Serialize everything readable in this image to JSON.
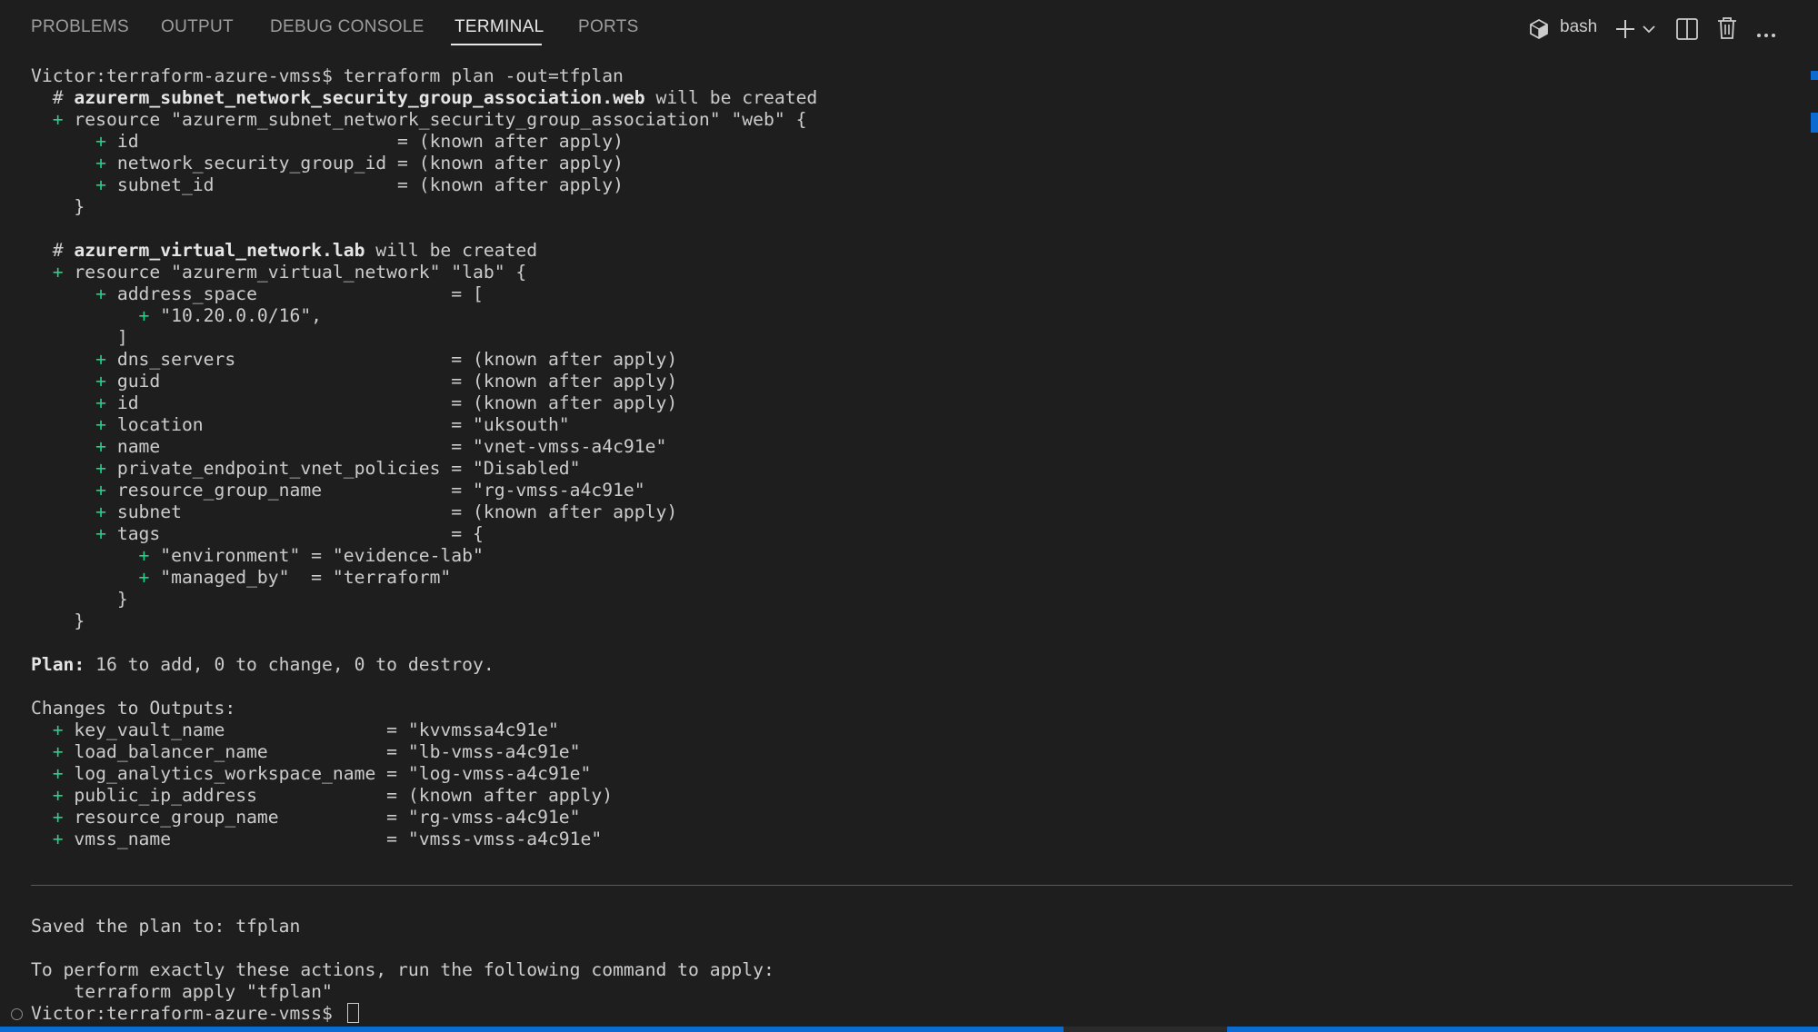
{
  "panel": {
    "tabs": [
      {
        "label": "PROBLEMS"
      },
      {
        "label": "OUTPUT"
      },
      {
        "label": "DEBUG CONSOLE"
      },
      {
        "label": "TERMINAL"
      },
      {
        "label": "PORTS"
      }
    ],
    "active_tab": "TERMINAL",
    "shell_label": "bash",
    "icons": {
      "shell": "terminal-shell-icon",
      "new_terminal": "plus-icon",
      "dropdown": "chevron-down-icon",
      "split": "split-terminal-icon",
      "kill": "trash-icon",
      "more": "ellipsis-icon"
    }
  },
  "terminal": {
    "lines": [
      [
        {
          "t": "Victor:terraform-azure-vmss$ terraform plan -out=tfplan"
        }
      ],
      [
        {
          "t": "  # "
        },
        {
          "t": "azurerm_subnet_network_security_group_association.web",
          "c": "bold"
        },
        {
          "t": " will be created"
        }
      ],
      [
        {
          "t": "  "
        },
        {
          "t": "+",
          "c": "plus"
        },
        {
          "t": " resource \"azurerm_subnet_network_security_group_association\" \"web\" {"
        }
      ],
      [
        {
          "t": "      "
        },
        {
          "t": "+",
          "c": "plus"
        },
        {
          "t": " id                        = (known after apply)"
        }
      ],
      [
        {
          "t": "      "
        },
        {
          "t": "+",
          "c": "plus"
        },
        {
          "t": " network_security_group_id = (known after apply)"
        }
      ],
      [
        {
          "t": "      "
        },
        {
          "t": "+",
          "c": "plus"
        },
        {
          "t": " subnet_id                 = (known after apply)"
        }
      ],
      [
        {
          "t": "    }"
        }
      ],
      [
        {
          "t": ""
        }
      ],
      [
        {
          "t": "  # "
        },
        {
          "t": "azurerm_virtual_network.lab",
          "c": "bold"
        },
        {
          "t": " will be created"
        }
      ],
      [
        {
          "t": "  "
        },
        {
          "t": "+",
          "c": "plus"
        },
        {
          "t": " resource \"azurerm_virtual_network\" \"lab\" {"
        }
      ],
      [
        {
          "t": "      "
        },
        {
          "t": "+",
          "c": "plus"
        },
        {
          "t": " address_space                  = ["
        }
      ],
      [
        {
          "t": "          "
        },
        {
          "t": "+",
          "c": "plus"
        },
        {
          "t": " \"10.20.0.0/16\","
        }
      ],
      [
        {
          "t": "        ]"
        }
      ],
      [
        {
          "t": "      "
        },
        {
          "t": "+",
          "c": "plus"
        },
        {
          "t": " dns_servers                    = (known after apply)"
        }
      ],
      [
        {
          "t": "      "
        },
        {
          "t": "+",
          "c": "plus"
        },
        {
          "t": " guid                           = (known after apply)"
        }
      ],
      [
        {
          "t": "      "
        },
        {
          "t": "+",
          "c": "plus"
        },
        {
          "t": " id                             = (known after apply)"
        }
      ],
      [
        {
          "t": "      "
        },
        {
          "t": "+",
          "c": "plus"
        },
        {
          "t": " location                       = \"uksouth\""
        }
      ],
      [
        {
          "t": "      "
        },
        {
          "t": "+",
          "c": "plus"
        },
        {
          "t": " name                           = \"vnet-vmss-a4c91e\""
        }
      ],
      [
        {
          "t": "      "
        },
        {
          "t": "+",
          "c": "plus"
        },
        {
          "t": " private_endpoint_vnet_policies = \"Disabled\""
        }
      ],
      [
        {
          "t": "      "
        },
        {
          "t": "+",
          "c": "plus"
        },
        {
          "t": " resource_group_name            = \"rg-vmss-a4c91e\""
        }
      ],
      [
        {
          "t": "      "
        },
        {
          "t": "+",
          "c": "plus"
        },
        {
          "t": " subnet                         = (known after apply)"
        }
      ],
      [
        {
          "t": "      "
        },
        {
          "t": "+",
          "c": "plus"
        },
        {
          "t": " tags                           = {"
        }
      ],
      [
        {
          "t": "          "
        },
        {
          "t": "+",
          "c": "plus"
        },
        {
          "t": " \"environment\" = \"evidence-lab\""
        }
      ],
      [
        {
          "t": "          "
        },
        {
          "t": "+",
          "c": "plus"
        },
        {
          "t": " \"managed_by\"  = \"terraform\""
        }
      ],
      [
        {
          "t": "        }"
        }
      ],
      [
        {
          "t": "    }"
        }
      ],
      [
        {
          "t": ""
        }
      ],
      [
        {
          "t": "Plan:",
          "c": "bold"
        },
        {
          "t": " 16 to add, 0 to change, 0 to destroy."
        }
      ],
      [
        {
          "t": ""
        }
      ],
      [
        {
          "t": "Changes to Outputs:"
        }
      ],
      [
        {
          "t": "  "
        },
        {
          "t": "+",
          "c": "plus"
        },
        {
          "t": " key_vault_name               = \"kvvmssa4c91e\""
        }
      ],
      [
        {
          "t": "  "
        },
        {
          "t": "+",
          "c": "plus"
        },
        {
          "t": " load_balancer_name           = \"lb-vmss-a4c91e\""
        }
      ],
      [
        {
          "t": "  "
        },
        {
          "t": "+",
          "c": "plus"
        },
        {
          "t": " log_analytics_workspace_name = \"log-vmss-a4c91e\""
        }
      ],
      [
        {
          "t": "  "
        },
        {
          "t": "+",
          "c": "plus"
        },
        {
          "t": " public_ip_address            = (known after apply)"
        }
      ],
      [
        {
          "t": "  "
        },
        {
          "t": "+",
          "c": "plus"
        },
        {
          "t": " resource_group_name          = \"rg-vmss-a4c91e\""
        }
      ],
      [
        {
          "t": "  "
        },
        {
          "t": "+",
          "c": "plus"
        },
        {
          "t": " vmss_name                    = \"vmss-vmss-a4c91e\""
        }
      ],
      [
        {
          "t": ""
        }
      ],
      [
        {
          "t": ""
        }
      ],
      [
        {
          "t": ""
        }
      ],
      [
        {
          "t": "Saved the plan to: tfplan"
        }
      ],
      [
        {
          "t": ""
        }
      ],
      [
        {
          "t": "To perform exactly these actions, run the following command to apply:"
        }
      ],
      [
        {
          "t": "    terraform apply \"tfplan\""
        }
      ],
      [
        {
          "t": "Victor:terraform-azure-vmss$ "
        }
      ]
    ]
  },
  "colors": {
    "background": "#1e1e1e",
    "text": "#cccccc",
    "plus": "#23d18b",
    "accent": "#0b6bd1"
  }
}
